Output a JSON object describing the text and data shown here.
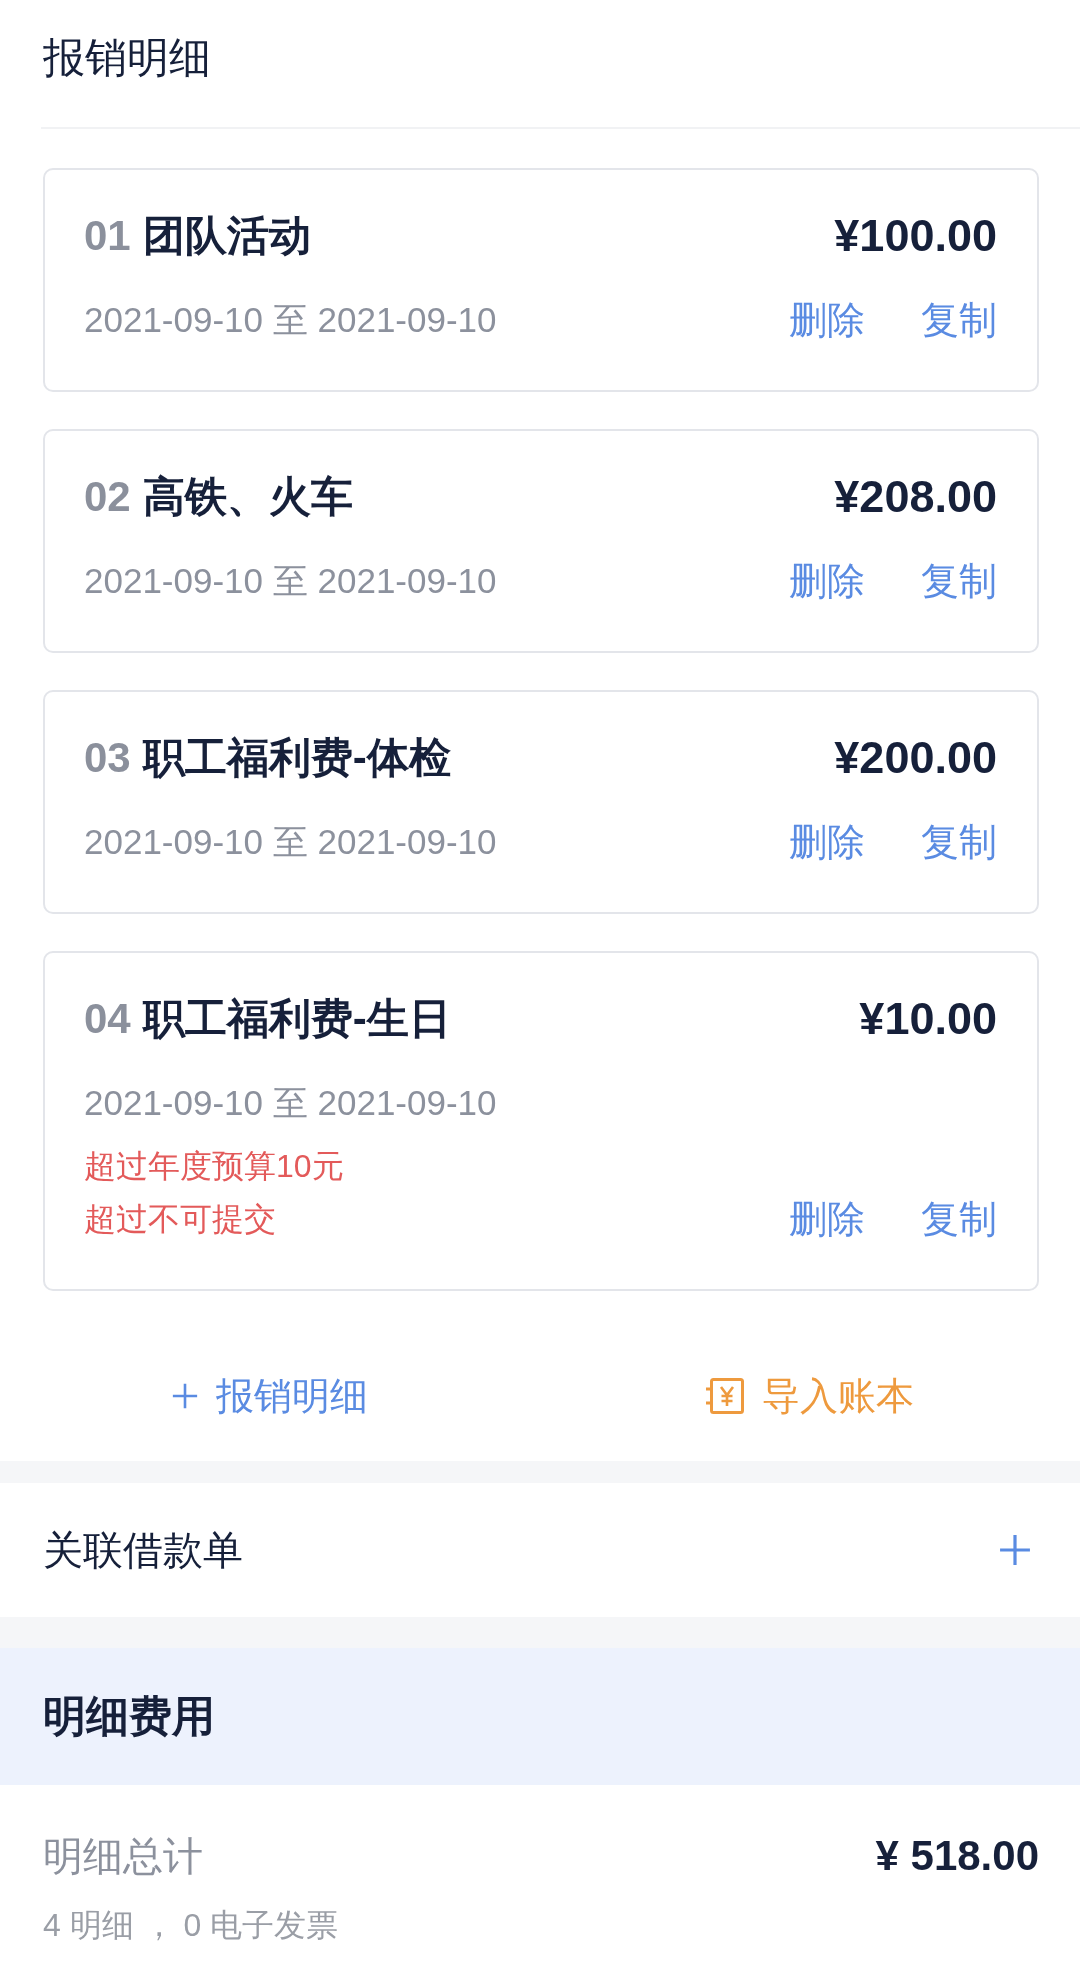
{
  "header": {
    "title": "报销明细"
  },
  "items": [
    {
      "index": "01",
      "name": "团队活动",
      "amount": "¥100.00",
      "date_range": "2021-09-10 至 2021-09-10",
      "actions": [
        "删除",
        "复制"
      ]
    },
    {
      "index": "02",
      "name": "高铁、火车",
      "amount": "¥208.00",
      "date_range": "2021-09-10 至 2021-09-10",
      "actions": [
        "删除",
        "复制"
      ]
    },
    {
      "index": "03",
      "name": "职工福利费-体检",
      "amount": "¥200.00",
      "date_range": "2021-09-10 至 2021-09-10",
      "actions": [
        "删除",
        "复制"
      ]
    },
    {
      "index": "04",
      "name": "职工福利费-生日",
      "amount": "¥10.00",
      "date_range": "2021-09-10 至 2021-09-10",
      "warnings": [
        "超过年度预算10元",
        "超过不可提交"
      ],
      "actions": [
        "删除",
        "复制"
      ]
    }
  ],
  "item_actions": [
    {
      "kind": "add",
      "label": "报销明细"
    },
    {
      "kind": "import",
      "label": "导入账本"
    }
  ],
  "linked_loan": {
    "label": "关联借款单"
  },
  "summary": {
    "title": "明细费用",
    "total_label": "明细总计",
    "total": "¥ 518.00",
    "count_text": "4 明细 ， 0 电子发票"
  }
}
